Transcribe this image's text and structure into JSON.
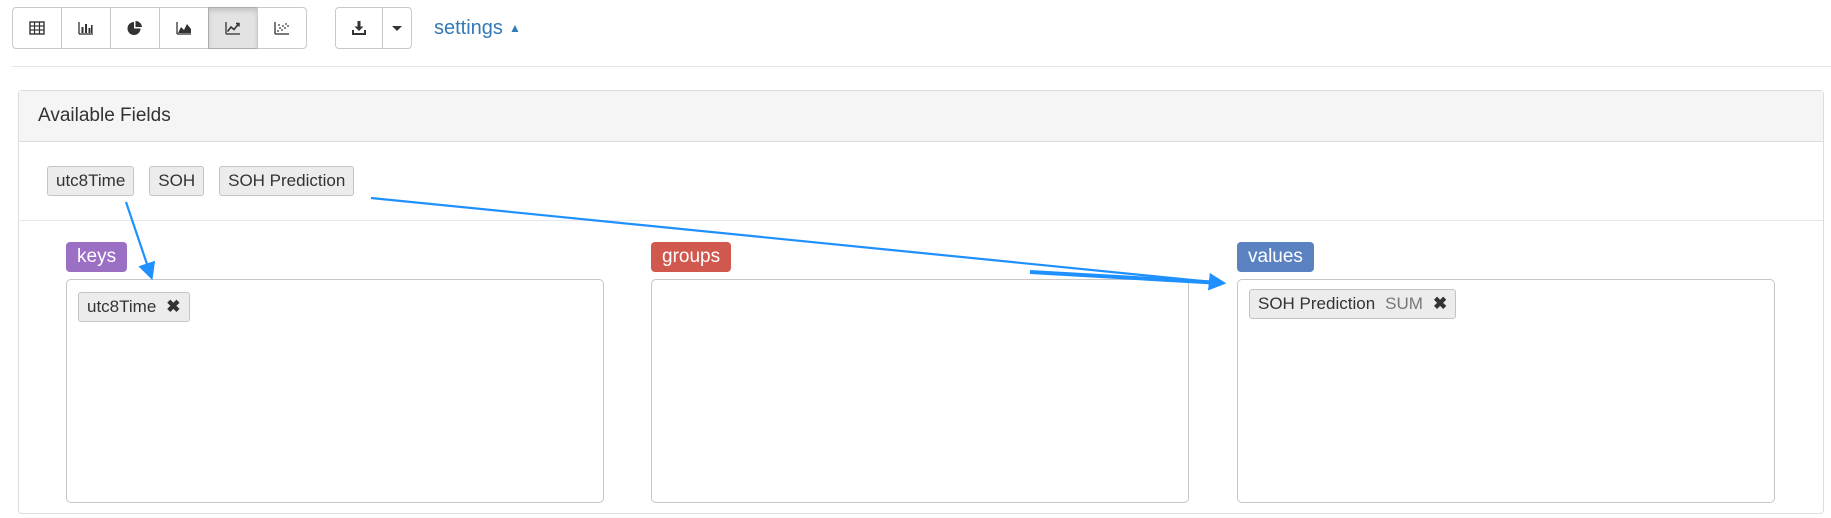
{
  "toolbar": {
    "chart_buttons": [
      {
        "name": "table-view-button",
        "icon": "table-icon",
        "active": false
      },
      {
        "name": "bar-chart-button",
        "icon": "bar-chart-icon",
        "active": false
      },
      {
        "name": "pie-chart-button",
        "icon": "pie-chart-icon",
        "active": false
      },
      {
        "name": "area-chart-button",
        "icon": "area-chart-icon",
        "active": false
      },
      {
        "name": "line-chart-button",
        "icon": "line-chart-icon",
        "active": true
      },
      {
        "name": "scatter-chart-button",
        "icon": "scatter-chart-icon",
        "active": false
      }
    ],
    "download_icon": "download-icon",
    "caret_icon": "caret-down-icon",
    "settings_label": "settings",
    "settings_caret": "▲"
  },
  "panel": {
    "title": "Available Fields",
    "fields": [
      "utc8Time",
      "SOH",
      "SOH Prediction"
    ]
  },
  "zones": {
    "keys": {
      "label": "keys",
      "color": "#9b6fc4",
      "items": [
        {
          "name": "utc8Time",
          "close": "✖"
        }
      ]
    },
    "groups": {
      "label": "groups",
      "color": "#d0584f",
      "items": []
    },
    "values": {
      "label": "values",
      "color": "#5b82c0",
      "items": [
        {
          "name": "SOH Prediction",
          "agg": "SUM",
          "close": "✖"
        }
      ]
    }
  },
  "colors": {
    "link": "#337ab7",
    "arrow": "#1e90ff"
  }
}
